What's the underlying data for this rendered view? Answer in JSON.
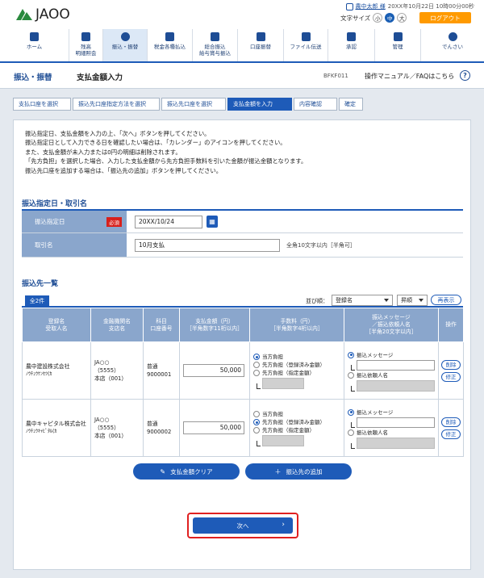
{
  "header": {
    "logo_text": "JAOO",
    "user_name": "農中太郎 様",
    "last_login": "20XX年10月22日 10時00分00秒",
    "font_size_label": "文字サイズ",
    "font_sizes": [
      "小",
      "中",
      "大"
    ],
    "logout": "ログアウト"
  },
  "nav": [
    {
      "label": "ホーム"
    },
    {
      "label": "残高\n明細照会"
    },
    {
      "label": "振込・振替"
    },
    {
      "label": "税金各種払込"
    },
    {
      "label": "総合振込\n給与賞与振込"
    },
    {
      "label": "口座振替"
    },
    {
      "label": "ファイル伝送"
    },
    {
      "label": "承認"
    },
    {
      "label": "管理"
    },
    {
      "label": "でんさい"
    }
  ],
  "page": {
    "category": "振込・振替",
    "title": "支払金額入力",
    "screen_id": "BFKF011",
    "help": "操作マニュアル／FAQはこちら"
  },
  "steps": [
    "支払口座を選択",
    "振込先口座指定方法を選択",
    "振込先口座を選択",
    "支払金額を入力",
    "内容確認",
    "確定"
  ],
  "intro": [
    "振込指定日、支払金額を入力の上、「次へ」ボタンを押してください。",
    "振込指定日として入力できる日を確認したい場合は、「カレンダー」のアイコンを押してください。",
    "また、支払金額が未入力または0円の明細は削除されます。",
    "「先方負担」を選択した場合、入力した支払金額から先方負担手数料を引いた金額が振込金額となります。",
    "振込先口座を追加する場合は、「振込先の追加」ボタンを押してください。"
  ],
  "section1": {
    "title": "振込指定日・取引名",
    "date_label": "振込指定日",
    "required": "必須",
    "date_value": "20XX/10/24",
    "name_label": "取引名",
    "name_value": "10月支払",
    "name_hint": "全角10文字以内［半角可］"
  },
  "section2": {
    "title": "振込先一覧",
    "count": "全2件",
    "sort_label": "並び順：",
    "sort_key": "登録名",
    "sort_order": "昇順",
    "resort": "再表示"
  },
  "columns": [
    "登録名\n受取人名",
    "金融機関名\n支店名",
    "科目\n口座番号",
    "支払金額（円）\n［半角数字11桁以内］",
    "手数料（円）\n［半角数字4桁以内］",
    "振込メッセージ\n／振込依頼人名\n［半角20文字以内］",
    "操作"
  ],
  "rows": [
    {
      "name": "農中建設株式会社",
      "kana": "ﾉｳﾁｭｳｹﾝｾﾂ(ｶ",
      "bank": "JA○○",
      "bank_code": "（5555）",
      "branch": "本店（001）",
      "type": "普通",
      "acct": "9000001",
      "amount": "50,000",
      "fee_selected": 0
    },
    {
      "name": "農中キャピタル株式会社",
      "kana": "ﾉｳﾁｭｳｷｬﾋﾟﾀﾙ(ｶ",
      "bank": "JA○○",
      "bank_code": "（5555）",
      "branch": "本店（001）",
      "type": "普通",
      "acct": "9000002",
      "amount": "50,000",
      "fee_selected": 1
    }
  ],
  "fee_options": [
    "当方負担",
    "先方負担（登録済み金額）",
    "先方負担（指定金額）"
  ],
  "msg_options": [
    "振込メッセージ",
    "振込依頼人名"
  ],
  "ops": {
    "delete": "削除",
    "edit": "修正"
  },
  "buttons": {
    "clear": "支払金額クリア",
    "add": "振込先の追加",
    "next": "次へ"
  }
}
